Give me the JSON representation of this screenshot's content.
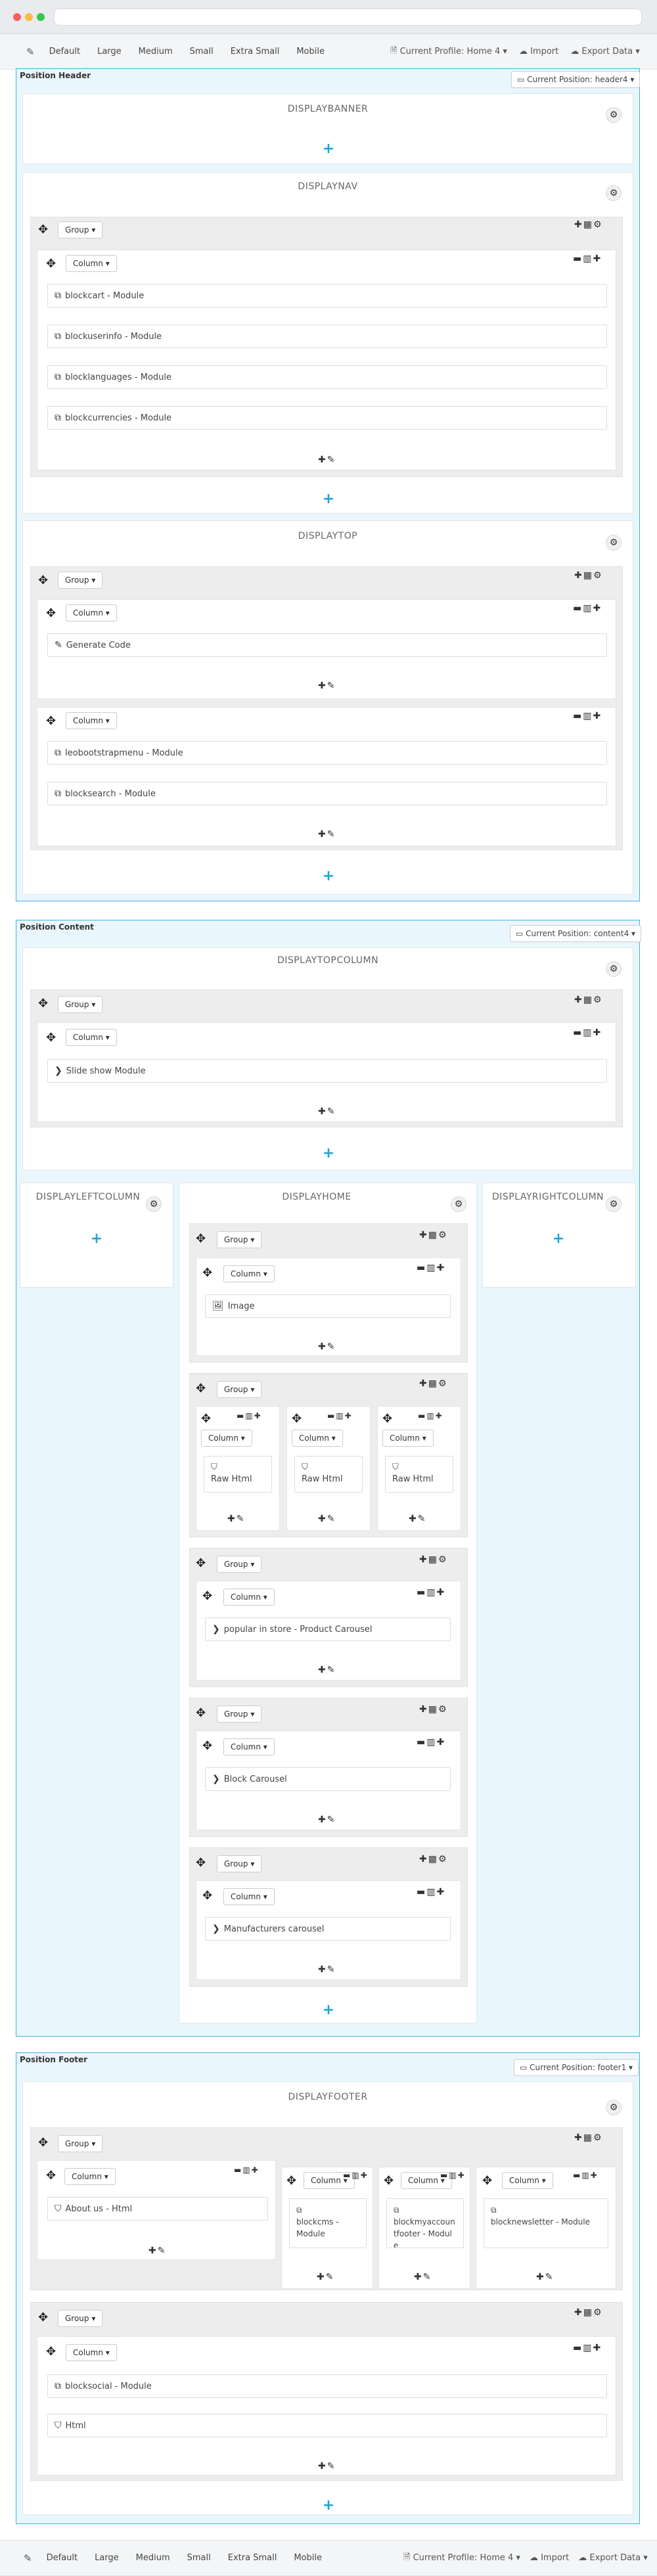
{
  "toolbar": {
    "devices": [
      "Default",
      "Large",
      "Medium",
      "Small",
      "Extra Small",
      "Mobile"
    ],
    "profile": "Current Profile: Home 4",
    "import": "Import",
    "export": "Export Data"
  },
  "header": {
    "title": "Position Header",
    "position": "Current Position: header4",
    "displaybanner": "DISPLAYBANNER",
    "displaynav": "DISPLAYNAV",
    "displaytop": "DISPLAYTOP",
    "nav_modules": [
      "blockcart - Module",
      "blockuserinfo - Module",
      "blocklanguages - Module",
      "blockcurrencies - Module"
    ],
    "top_col1": [
      "Generate Code"
    ],
    "top_col2": [
      "leobootstrapmenu - Module",
      "blocksearch - Module"
    ]
  },
  "content": {
    "title": "Position Content",
    "position": "Current Position: content4",
    "topcolumn": "DISPLAYTOPCOLUMN",
    "slideshow": "Slide show Module",
    "leftcolumn": "DISPLAYLEFTCOLUMN",
    "home": "DISPLAYHOME",
    "rightcolumn": "DISPLAYRIGHTCOLUMN",
    "image": "Image",
    "rawhtml": "Raw Html",
    "popular": "popular in store - Product Carousel",
    "block_carousel": "Block Carousel",
    "manufacturers": "Manufacturers carousel"
  },
  "footer": {
    "title": "Position Footer",
    "position": "Current Position: footer1",
    "displayfooter": "DISPLAYFOOTER",
    "aboutus": "About us - Html",
    "blockcms": "blockcms - Module",
    "blockmyaccount": "blockmyaccountfooter - Module",
    "blocknewsletter": "blocknewsletter - Module",
    "blocksocial": "blocksocial - Module",
    "html": "Html"
  },
  "labels": {
    "group": "Group",
    "column": "Column"
  }
}
